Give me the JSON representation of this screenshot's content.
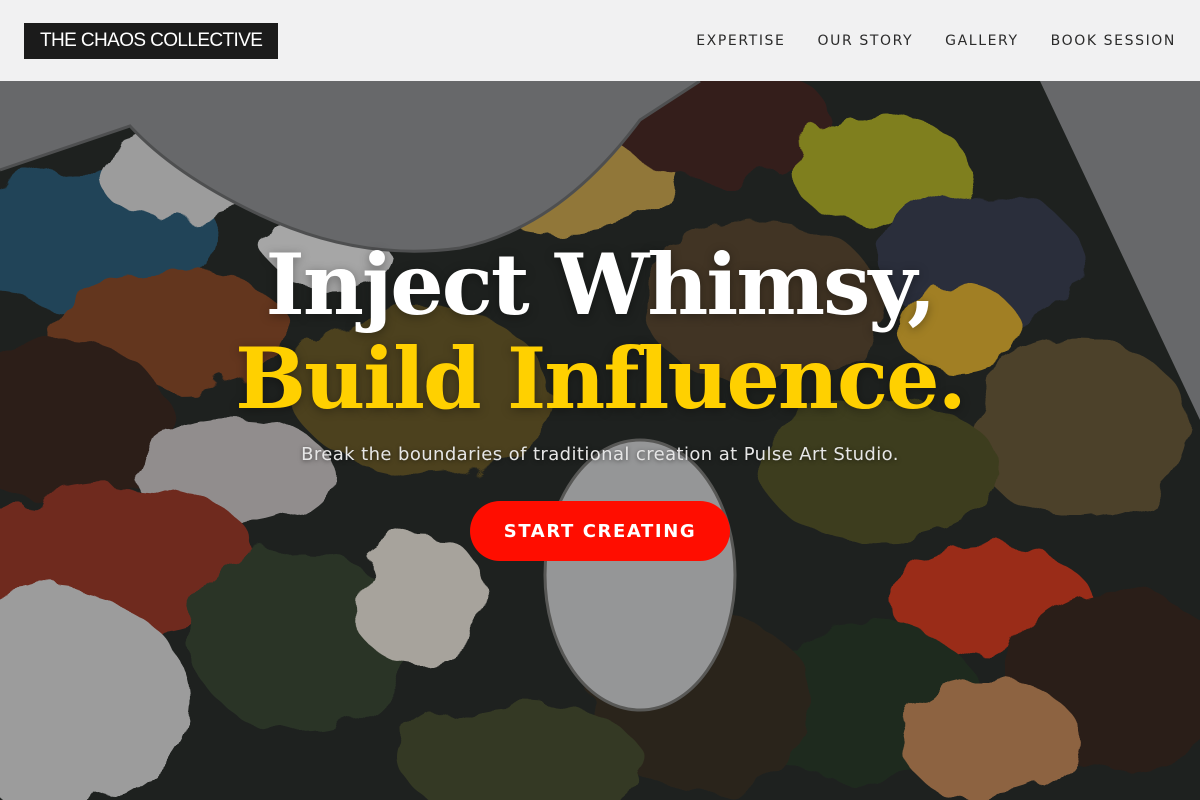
{
  "header": {
    "logo_text": "THE CHAOS COLLECTIVE",
    "nav": [
      {
        "label": "EXPERTISE"
      },
      {
        "label": "OUR STORY"
      },
      {
        "label": "GALLERY"
      },
      {
        "label": "BOOK SESSION"
      }
    ]
  },
  "hero": {
    "headline_line1": "Inject Whimsy,",
    "headline_line2": "Build Influence.",
    "subtitle": "Break the boundaries of traditional creation at Pulse Art Studio.",
    "cta_label": "START CREATING",
    "background_image": "paint-palette-photo"
  },
  "colors": {
    "accent_yellow": "#ffd000",
    "cta_red": "#ff0d00",
    "logo_bg": "#1b1b1b",
    "header_bg": "#f6f6f7"
  }
}
